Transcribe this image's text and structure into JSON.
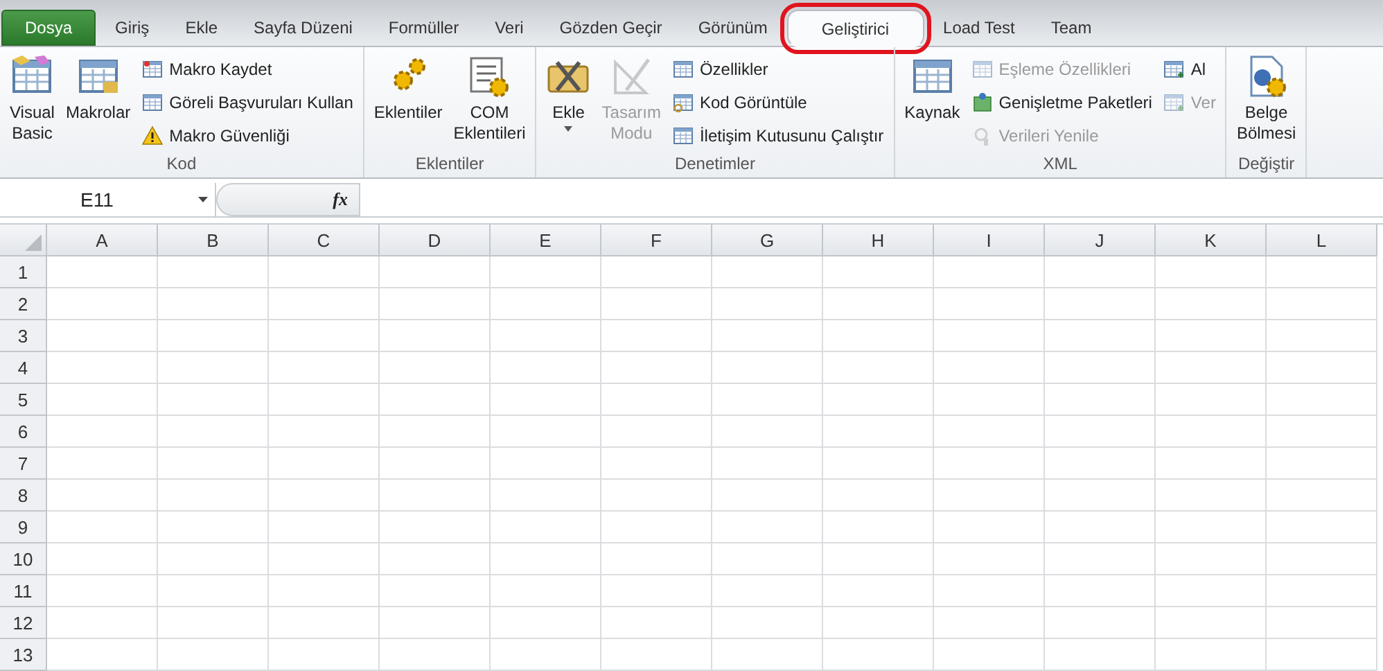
{
  "tabs": [
    {
      "label": "Dosya",
      "kind": "file",
      "selected": false,
      "highlighted": false
    },
    {
      "label": "Giriş",
      "kind": "tab",
      "selected": false,
      "highlighted": false
    },
    {
      "label": "Ekle",
      "kind": "tab",
      "selected": false,
      "highlighted": false
    },
    {
      "label": "Sayfa Düzeni",
      "kind": "tab",
      "selected": false,
      "highlighted": false
    },
    {
      "label": "Formüller",
      "kind": "tab",
      "selected": false,
      "highlighted": false
    },
    {
      "label": "Veri",
      "kind": "tab",
      "selected": false,
      "highlighted": false
    },
    {
      "label": "Gözden Geçir",
      "kind": "tab",
      "selected": false,
      "highlighted": false
    },
    {
      "label": "Görünüm",
      "kind": "tab",
      "selected": false,
      "highlighted": false
    },
    {
      "label": "Geliştirici",
      "kind": "tab",
      "selected": true,
      "highlighted": true
    },
    {
      "label": "Load Test",
      "kind": "tab",
      "selected": false,
      "highlighted": false
    },
    {
      "label": "Team",
      "kind": "tab",
      "selected": false,
      "highlighted": false
    }
  ],
  "ribbon_groups": [
    {
      "label": "Kod",
      "columns": [
        {
          "kind": "large",
          "label": "Visual Basic",
          "disabled": false,
          "dropdown": false
        },
        {
          "kind": "large",
          "label": "Makrolar",
          "disabled": false,
          "dropdown": false
        },
        {
          "kind": "stack",
          "items": [
            {
              "label": "Makro Kaydet",
              "disabled": false
            },
            {
              "label": "Göreli Başvuruları Kullan",
              "disabled": false
            },
            {
              "label": "Makro Güvenliği",
              "disabled": false
            }
          ]
        }
      ]
    },
    {
      "label": "Eklentiler",
      "columns": [
        {
          "kind": "large",
          "label": "Eklentiler",
          "disabled": false,
          "dropdown": false
        },
        {
          "kind": "large",
          "label": "COM Eklentileri",
          "disabled": false,
          "dropdown": false
        }
      ]
    },
    {
      "label": "Denetimler",
      "columns": [
        {
          "kind": "large",
          "label": "Ekle",
          "disabled": false,
          "dropdown": true
        },
        {
          "kind": "large",
          "label": "Tasarım Modu",
          "disabled": true,
          "dropdown": false
        },
        {
          "kind": "stack",
          "items": [
            {
              "label": "Özellikler",
              "disabled": false
            },
            {
              "label": "Kod Görüntüle",
              "disabled": false
            },
            {
              "label": "İletişim Kutusunu Çalıştır",
              "disabled": false
            }
          ]
        }
      ]
    },
    {
      "label": "XML",
      "columns": [
        {
          "kind": "large",
          "label": "Kaynak",
          "disabled": false,
          "dropdown": false
        },
        {
          "kind": "stack",
          "items": [
            {
              "label": "Eşleme Özellikleri",
              "disabled": true
            },
            {
              "label": "Genişletme Paketleri",
              "disabled": false
            },
            {
              "label": "Verileri Yenile",
              "disabled": true
            }
          ]
        },
        {
          "kind": "stack",
          "items": [
            {
              "label": "Al",
              "disabled": false
            },
            {
              "label": "Ver",
              "disabled": true
            }
          ]
        }
      ]
    },
    {
      "label": "Değiştir",
      "columns": [
        {
          "kind": "large",
          "label": "Belge Bölmesi",
          "disabled": false,
          "dropdown": false
        }
      ]
    }
  ],
  "formula_bar": {
    "name_box": "E11",
    "fx_label": "fx"
  },
  "sheet": {
    "columns": [
      "A",
      "B",
      "C",
      "D",
      "E",
      "F",
      "G",
      "H",
      "I",
      "J",
      "K",
      "L"
    ],
    "rows": [
      "1",
      "2",
      "3",
      "4",
      "5",
      "6",
      "7",
      "8",
      "9",
      "10",
      "11",
      "12",
      "13"
    ]
  }
}
